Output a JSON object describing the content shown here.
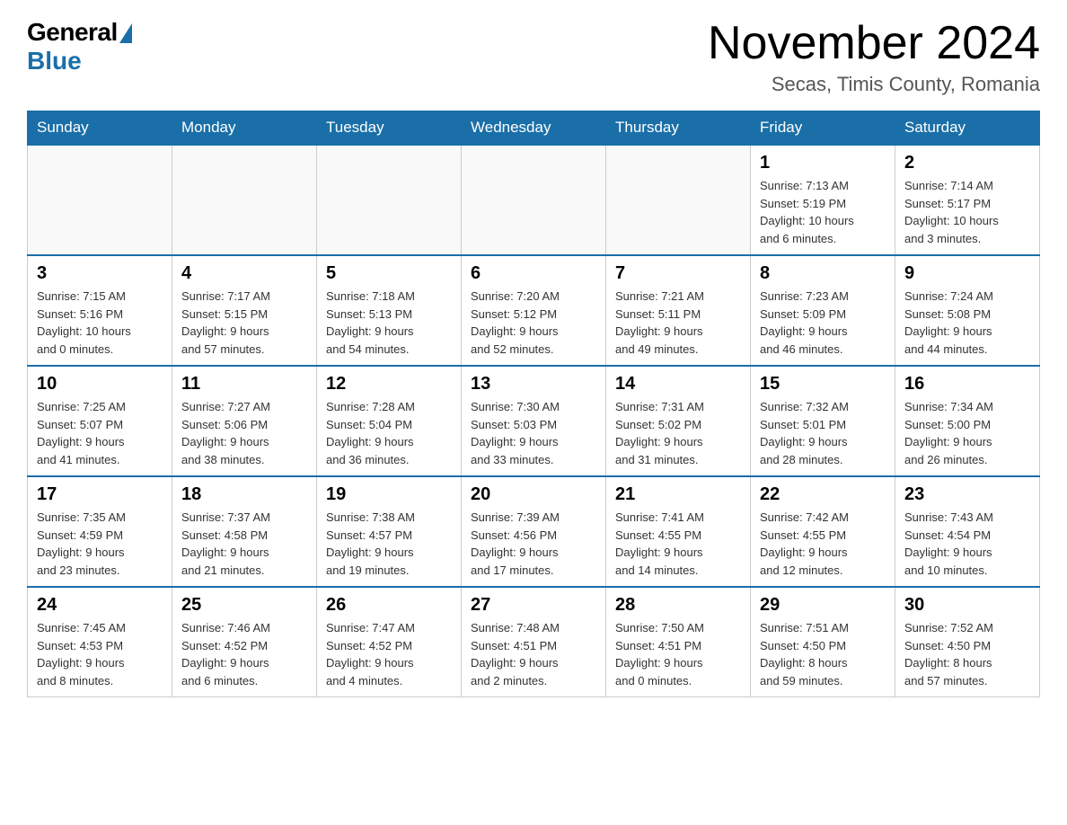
{
  "logo": {
    "general_text": "General",
    "blue_text": "Blue"
  },
  "title": {
    "month_year": "November 2024",
    "location": "Secas, Timis County, Romania"
  },
  "days_of_week": [
    "Sunday",
    "Monday",
    "Tuesday",
    "Wednesday",
    "Thursday",
    "Friday",
    "Saturday"
  ],
  "weeks": [
    [
      {
        "day": null
      },
      {
        "day": null
      },
      {
        "day": null
      },
      {
        "day": null
      },
      {
        "day": null
      },
      {
        "day": "1",
        "sunrise": "7:13 AM",
        "sunset": "5:19 PM",
        "daylight": "10 hours and 6 minutes."
      },
      {
        "day": "2",
        "sunrise": "7:14 AM",
        "sunset": "5:17 PM",
        "daylight": "10 hours and 3 minutes."
      }
    ],
    [
      {
        "day": "3",
        "sunrise": "7:15 AM",
        "sunset": "5:16 PM",
        "daylight": "10 hours and 0 minutes."
      },
      {
        "day": "4",
        "sunrise": "7:17 AM",
        "sunset": "5:15 PM",
        "daylight": "9 hours and 57 minutes."
      },
      {
        "day": "5",
        "sunrise": "7:18 AM",
        "sunset": "5:13 PM",
        "daylight": "9 hours and 54 minutes."
      },
      {
        "day": "6",
        "sunrise": "7:20 AM",
        "sunset": "5:12 PM",
        "daylight": "9 hours and 52 minutes."
      },
      {
        "day": "7",
        "sunrise": "7:21 AM",
        "sunset": "5:11 PM",
        "daylight": "9 hours and 49 minutes."
      },
      {
        "day": "8",
        "sunrise": "7:23 AM",
        "sunset": "5:09 PM",
        "daylight": "9 hours and 46 minutes."
      },
      {
        "day": "9",
        "sunrise": "7:24 AM",
        "sunset": "5:08 PM",
        "daylight": "9 hours and 44 minutes."
      }
    ],
    [
      {
        "day": "10",
        "sunrise": "7:25 AM",
        "sunset": "5:07 PM",
        "daylight": "9 hours and 41 minutes."
      },
      {
        "day": "11",
        "sunrise": "7:27 AM",
        "sunset": "5:06 PM",
        "daylight": "9 hours and 38 minutes."
      },
      {
        "day": "12",
        "sunrise": "7:28 AM",
        "sunset": "5:04 PM",
        "daylight": "9 hours and 36 minutes."
      },
      {
        "day": "13",
        "sunrise": "7:30 AM",
        "sunset": "5:03 PM",
        "daylight": "9 hours and 33 minutes."
      },
      {
        "day": "14",
        "sunrise": "7:31 AM",
        "sunset": "5:02 PM",
        "daylight": "9 hours and 31 minutes."
      },
      {
        "day": "15",
        "sunrise": "7:32 AM",
        "sunset": "5:01 PM",
        "daylight": "9 hours and 28 minutes."
      },
      {
        "day": "16",
        "sunrise": "7:34 AM",
        "sunset": "5:00 PM",
        "daylight": "9 hours and 26 minutes."
      }
    ],
    [
      {
        "day": "17",
        "sunrise": "7:35 AM",
        "sunset": "4:59 PM",
        "daylight": "9 hours and 23 minutes."
      },
      {
        "day": "18",
        "sunrise": "7:37 AM",
        "sunset": "4:58 PM",
        "daylight": "9 hours and 21 minutes."
      },
      {
        "day": "19",
        "sunrise": "7:38 AM",
        "sunset": "4:57 PM",
        "daylight": "9 hours and 19 minutes."
      },
      {
        "day": "20",
        "sunrise": "7:39 AM",
        "sunset": "4:56 PM",
        "daylight": "9 hours and 17 minutes."
      },
      {
        "day": "21",
        "sunrise": "7:41 AM",
        "sunset": "4:55 PM",
        "daylight": "9 hours and 14 minutes."
      },
      {
        "day": "22",
        "sunrise": "7:42 AM",
        "sunset": "4:55 PM",
        "daylight": "9 hours and 12 minutes."
      },
      {
        "day": "23",
        "sunrise": "7:43 AM",
        "sunset": "4:54 PM",
        "daylight": "9 hours and 10 minutes."
      }
    ],
    [
      {
        "day": "24",
        "sunrise": "7:45 AM",
        "sunset": "4:53 PM",
        "daylight": "9 hours and 8 minutes."
      },
      {
        "day": "25",
        "sunrise": "7:46 AM",
        "sunset": "4:52 PM",
        "daylight": "9 hours and 6 minutes."
      },
      {
        "day": "26",
        "sunrise": "7:47 AM",
        "sunset": "4:52 PM",
        "daylight": "9 hours and 4 minutes."
      },
      {
        "day": "27",
        "sunrise": "7:48 AM",
        "sunset": "4:51 PM",
        "daylight": "9 hours and 2 minutes."
      },
      {
        "day": "28",
        "sunrise": "7:50 AM",
        "sunset": "4:51 PM",
        "daylight": "9 hours and 0 minutes."
      },
      {
        "day": "29",
        "sunrise": "7:51 AM",
        "sunset": "4:50 PM",
        "daylight": "8 hours and 59 minutes."
      },
      {
        "day": "30",
        "sunrise": "7:52 AM",
        "sunset": "4:50 PM",
        "daylight": "8 hours and 57 minutes."
      }
    ]
  ],
  "labels": {
    "sunrise": "Sunrise:",
    "sunset": "Sunset:",
    "daylight": "Daylight:"
  },
  "colors": {
    "header_bg": "#1a6fa8",
    "header_text": "#ffffff"
  }
}
